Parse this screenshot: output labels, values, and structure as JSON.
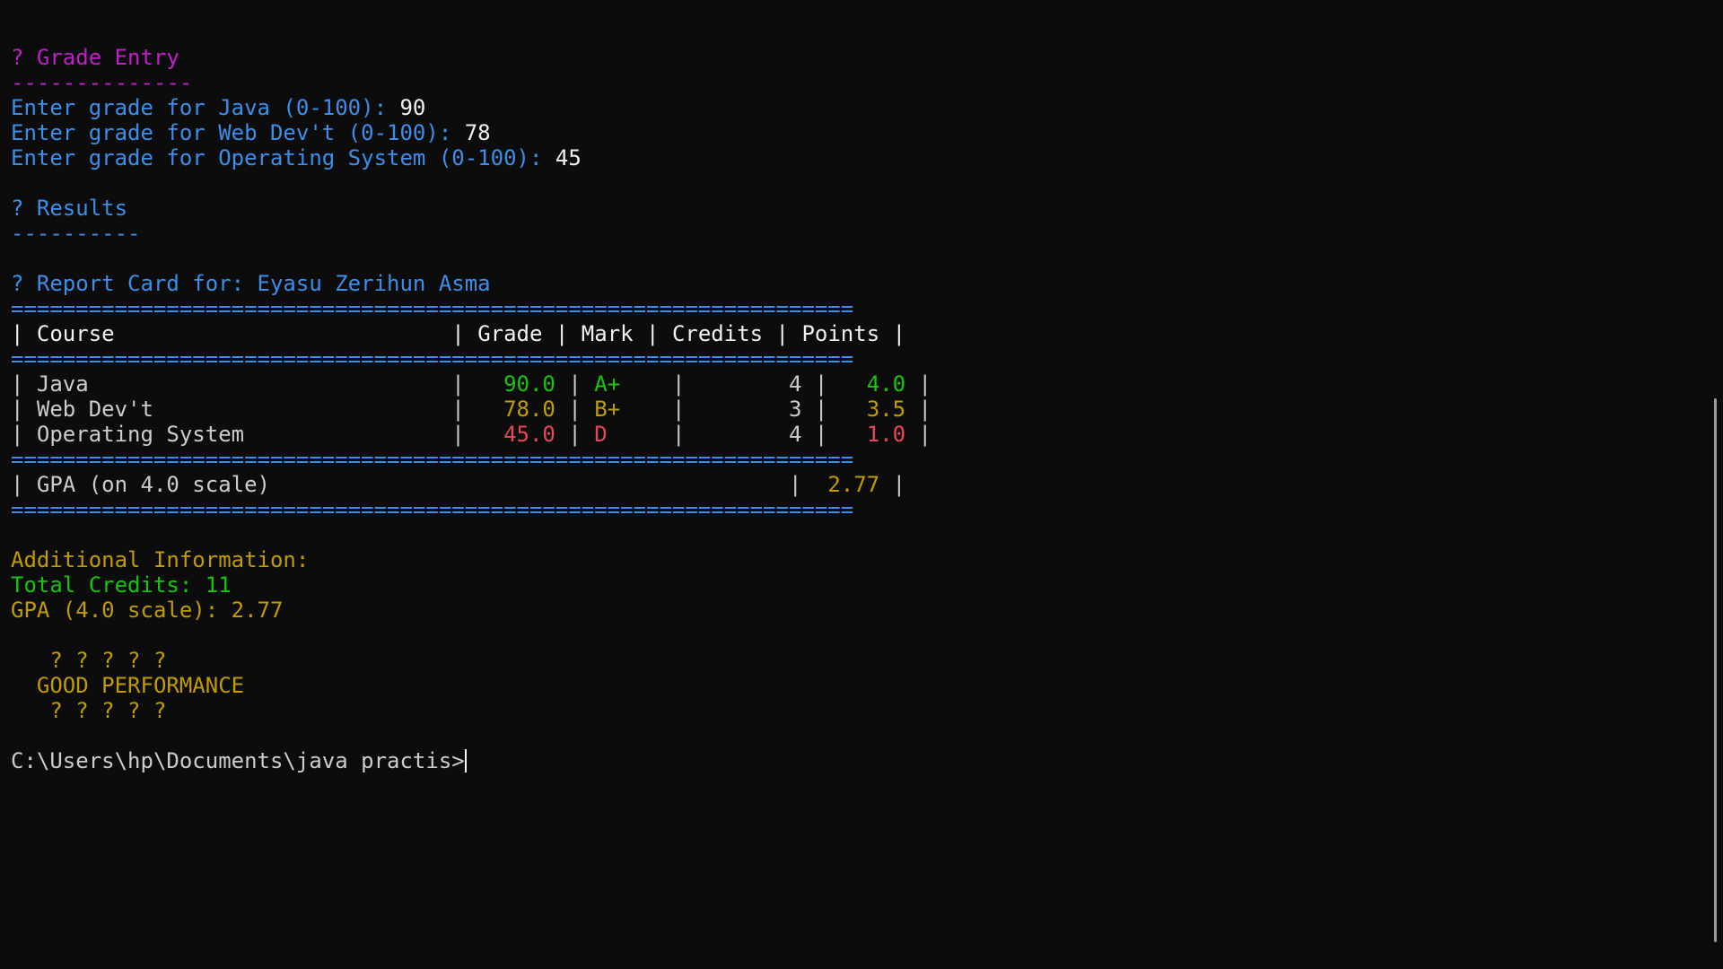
{
  "colors": {
    "magenta": "#c01ec8",
    "blue": "#3b8eea",
    "text": "#cccccc",
    "white": "#f2f2f2",
    "green": "#16c60c",
    "yellow": "#c19c00",
    "red": "#e74856"
  },
  "grade_entry": {
    "header": "? Grade Entry",
    "underline": "--------------",
    "prompts": [
      {
        "prompt": "Enter grade for Java (0-100): ",
        "value": "90"
      },
      {
        "prompt": "Enter grade for Web Dev't (0-100): ",
        "value": "78"
      },
      {
        "prompt": "Enter grade for Operating System (0-100): ",
        "value": "45"
      }
    ]
  },
  "results": {
    "header": "? Results",
    "underline": "----------"
  },
  "report": {
    "title": "? Report Card for: Eyasu Zerihun Asma",
    "rule": "=================================================================",
    "headers": {
      "sep1": "| ",
      "course": "Course                          ",
      "sep2": "| ",
      "grade": "Grade ",
      "sep3": "| ",
      "mark": "Mark ",
      "sep4": "| ",
      "credits": "Credits ",
      "sep5": "| ",
      "points": "Points ",
      "sep6": "|"
    },
    "rows": [
      {
        "lead": "| ",
        "course": "Java                            ",
        "sep2": "| ",
        "grade": "  90.0 ",
        "sep3": "| ",
        "mark": "A+    ",
        "sep4": "| ",
        "credits": "       4 ",
        "sep5": "| ",
        "points": "  4.0 ",
        "sep6": "|"
      },
      {
        "lead": "| ",
        "course": "Web Dev't                       ",
        "sep2": "| ",
        "grade": "  78.0 ",
        "sep3": "| ",
        "mark": "B+    ",
        "sep4": "| ",
        "credits": "       3 ",
        "sep5": "| ",
        "points": "  3.5 ",
        "sep6": "|"
      },
      {
        "lead": "| ",
        "course": "Operating System                ",
        "sep2": "| ",
        "grade": "  45.0 ",
        "sep3": "| ",
        "mark": "D     ",
        "sep4": "| ",
        "credits": "       4 ",
        "sep5": "| ",
        "points": "  1.0 ",
        "sep6": "|"
      }
    ],
    "gpa_row": {
      "lead": "| ",
      "label": "GPA (on 4.0 scale)                                        ",
      "sep": "| ",
      "value": " 2.77 ",
      "end": "|"
    }
  },
  "additional": {
    "header": "Additional Information:",
    "total_credits": "Total Credits: 11",
    "gpa": "GPA (4.0 scale): 2.77"
  },
  "banner": {
    "top": "   ? ? ? ? ?",
    "message": "  GOOD PERFORMANCE",
    "bottom": "   ? ? ? ? ?"
  },
  "shell": {
    "prompt": "C:\\Users\\hp\\Documents\\java practis>"
  }
}
